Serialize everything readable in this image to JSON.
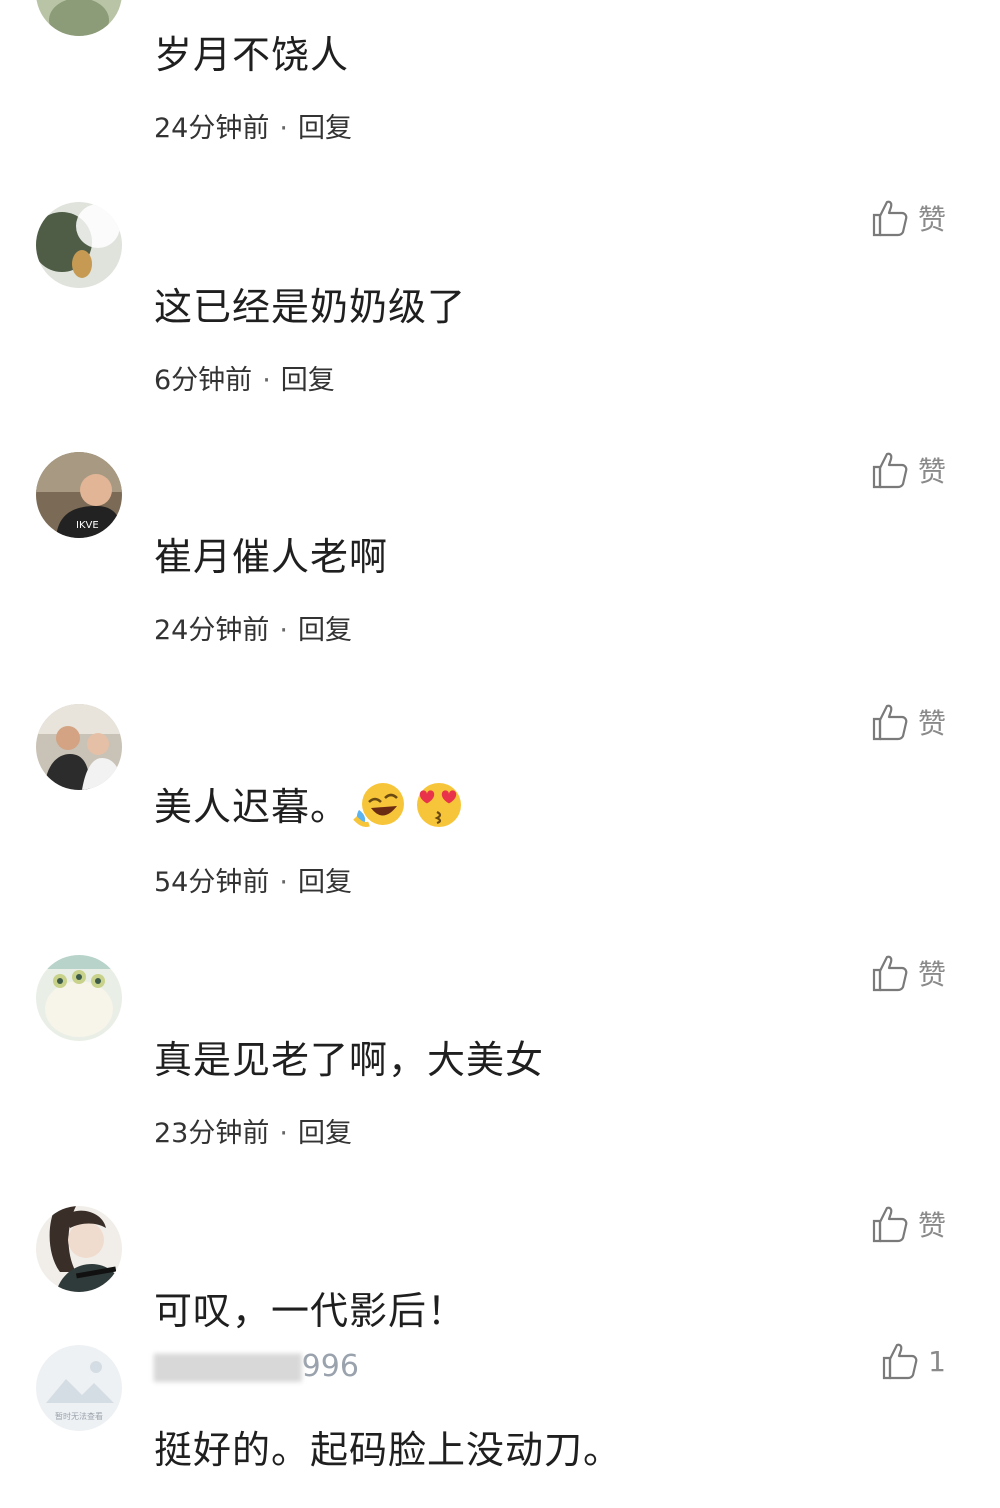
{
  "like_label": "赞",
  "dot": "·",
  "reply_label": "回复",
  "comments": [
    {
      "username": "",
      "content": "岁月不饶人",
      "time": "24分钟前",
      "like_text": ""
    },
    {
      "username": "",
      "content": "这已经是奶奶级了",
      "time": "6分钟前",
      "like_text": "赞"
    },
    {
      "username": "",
      "content": "崔月催人老啊",
      "time": "24分钟前",
      "like_text": "赞"
    },
    {
      "username": "",
      "content": "美人迟暮。",
      "emojis": [
        "rolling-laughing-emoji",
        "heart-eyes-kiss-emoji"
      ],
      "time": "54分钟前",
      "like_text": "赞"
    },
    {
      "username": "",
      "content": "真是见老了啊，大美女",
      "time": "23分钟前",
      "like_text": "赞"
    },
    {
      "username": "",
      "content": "可叹，一代影后！",
      "time": "",
      "like_text": "赞"
    },
    {
      "username_suffix": "996",
      "content": "挺好的。起码脸上没动刀。",
      "time": "",
      "like_text": "1"
    }
  ],
  "last_avatar_caption": "暂时无法查看",
  "colors": {
    "text_primary": "#1f1f1f",
    "text_meta": "#333333",
    "like_icon": "#7a7a7a"
  }
}
